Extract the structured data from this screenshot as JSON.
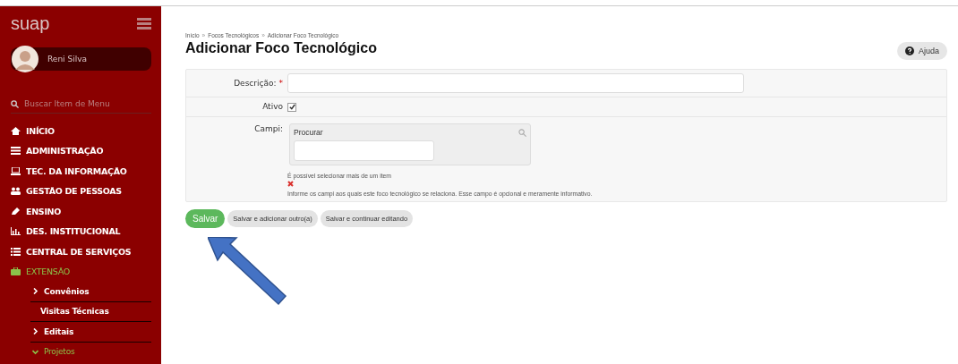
{
  "sidebar": {
    "logo": "suap",
    "user": {
      "name": "Reni Silva"
    },
    "search": {
      "placeholder": "Buscar Item de Menu"
    },
    "menu": [
      {
        "label": "INÍCIO",
        "selected": false
      },
      {
        "label": "ADMINISTRAÇÃO",
        "selected": false
      },
      {
        "label": "TEC. DA INFORMAÇÃO",
        "selected": false
      },
      {
        "label": "GESTÃO DE PESSOAS",
        "selected": false
      },
      {
        "label": "ENSINO",
        "selected": false
      },
      {
        "label": "DES. INSTITUCIONAL",
        "selected": false
      },
      {
        "label": "CENTRAL DE SERVIÇOS",
        "selected": false
      },
      {
        "label": "EXTENSÃO",
        "selected": true,
        "children": [
          {
            "label": "Convênios",
            "kind": "group",
            "expanded": false,
            "selected": false
          },
          {
            "label": "Visitas Técnicas",
            "kind": "link",
            "selected": false
          },
          {
            "label": "Editais",
            "kind": "group",
            "expanded": false,
            "selected": false
          },
          {
            "label": "Projetos",
            "kind": "group",
            "expanded": true,
            "selected": true
          }
        ]
      }
    ]
  },
  "breadcrumb": [
    "Início",
    "Focos Tecnológicos",
    "Adicionar Foco Tecnológico"
  ],
  "breadcrumb_separator": "»",
  "title": "Adicionar Foco Tecnológico",
  "help_button": "Ajuda",
  "form": {
    "descricao": {
      "label": "Descrição:",
      "required": true,
      "required_mark": "*"
    },
    "ativo": {
      "label": "Ativo",
      "checked": true
    },
    "campi": {
      "label": "Campi:",
      "search_label": "Procurar",
      "hint": "É possível selecionar mais de um item",
      "help": "Informe os campi aos quais este foco tecnológico se relaciona. Esse campo é opcional e meramente informativo."
    }
  },
  "buttons": [
    {
      "label": "Salvar",
      "kind": "primary"
    },
    {
      "label": "Salvar e adicionar outro(a)",
      "kind": "secondary"
    },
    {
      "label": "Salvar e continuar editando",
      "kind": "secondary"
    }
  ]
}
